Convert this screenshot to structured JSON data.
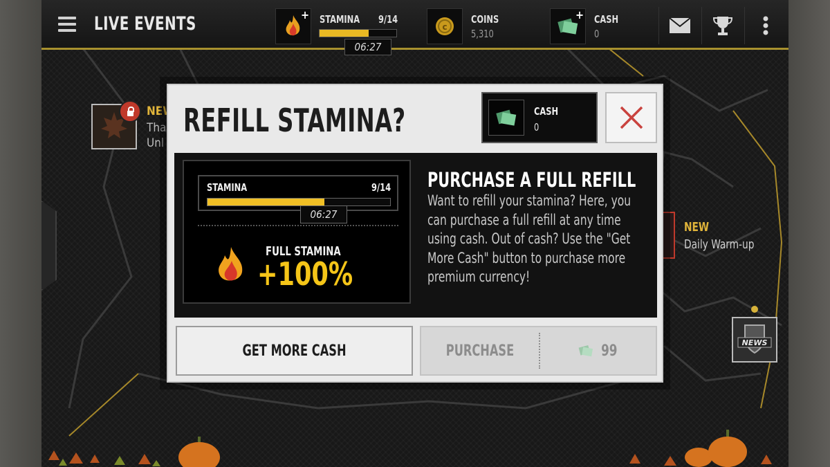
{
  "topbar": {
    "title": "LIVE EVENTS",
    "stamina": {
      "label": "STAMINA",
      "value": "9/14",
      "fill_fraction": 0.64,
      "timer": "06:27"
    },
    "coins": {
      "label": "COINS",
      "value": "5,310"
    },
    "cash": {
      "label": "CASH",
      "value": "0"
    }
  },
  "map": {
    "left_event": {
      "badge": "NEW",
      "line1": "Tha",
      "line2": "Unl"
    },
    "right_event": {
      "badge": "NEW",
      "name": "Daily Warm-up"
    },
    "news_label": "NEWS"
  },
  "modal": {
    "title": "REFILL STAMINA?",
    "cash_chip": {
      "label": "CASH",
      "value": "0"
    },
    "stamina_card": {
      "label": "STAMINA",
      "count": "9/14",
      "fill_fraction": 0.64,
      "timer": "06:27",
      "full_label": "FULL STAMINA",
      "percent": "+100%"
    },
    "info": {
      "title": "PURCHASE A FULL REFILL",
      "body": "Want to refill your stamina? Here, you can purchase a full refill at any time using cash. Out of cash? Use the \"Get More Cash\" button to purchase more premium currency!"
    },
    "buttons": {
      "get_more_cash": "GET MORE CASH",
      "purchase": "PURCHASE",
      "price": "99"
    }
  },
  "colors": {
    "accent_gold": "#f5c518",
    "close_red": "#c9423e",
    "cash_green": "#6fbf8f"
  }
}
